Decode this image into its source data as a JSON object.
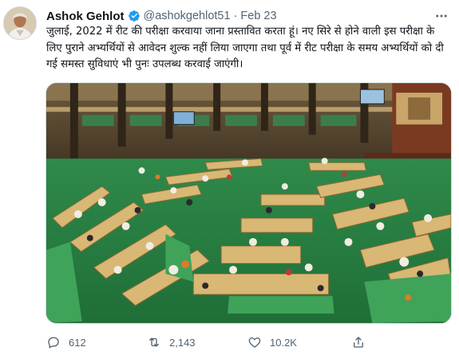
{
  "tweet": {
    "author_name": "Ashok Gehlot",
    "handle": "@ashokgehlot51",
    "separator": "·",
    "date": "Feb 23",
    "text": "जुलाई, 2022 में रीट की परीक्षा करवाया जाना प्रस्तावित करता हूं। नए सिरे से होने वाली इस परीक्षा के लिए पुराने अभ्यर्थियों से आवेदन शुल्क नहीं लिया जाएगा तथा पूर्व में रीट परीक्षा के समय अभ्यर्थियों को दी गई समस्त सुविधाएं भी पुनः उपलब्ध करवाई जाएंगी।",
    "media_icon": "photo-legislative-assembly-chamber"
  },
  "actions": {
    "reply_count": "612",
    "retweet_count": "2,143",
    "like_count": "10.2K"
  },
  "icons": {
    "verified": "verified-badge-icon",
    "more": "more-options-icon",
    "reply": "reply-icon",
    "retweet": "retweet-icon",
    "like": "like-icon",
    "share": "share-icon"
  },
  "colors": {
    "text": "#0f1419",
    "secondary": "#536471",
    "verified": "#1d9bf0",
    "border": "#cfd9de"
  }
}
